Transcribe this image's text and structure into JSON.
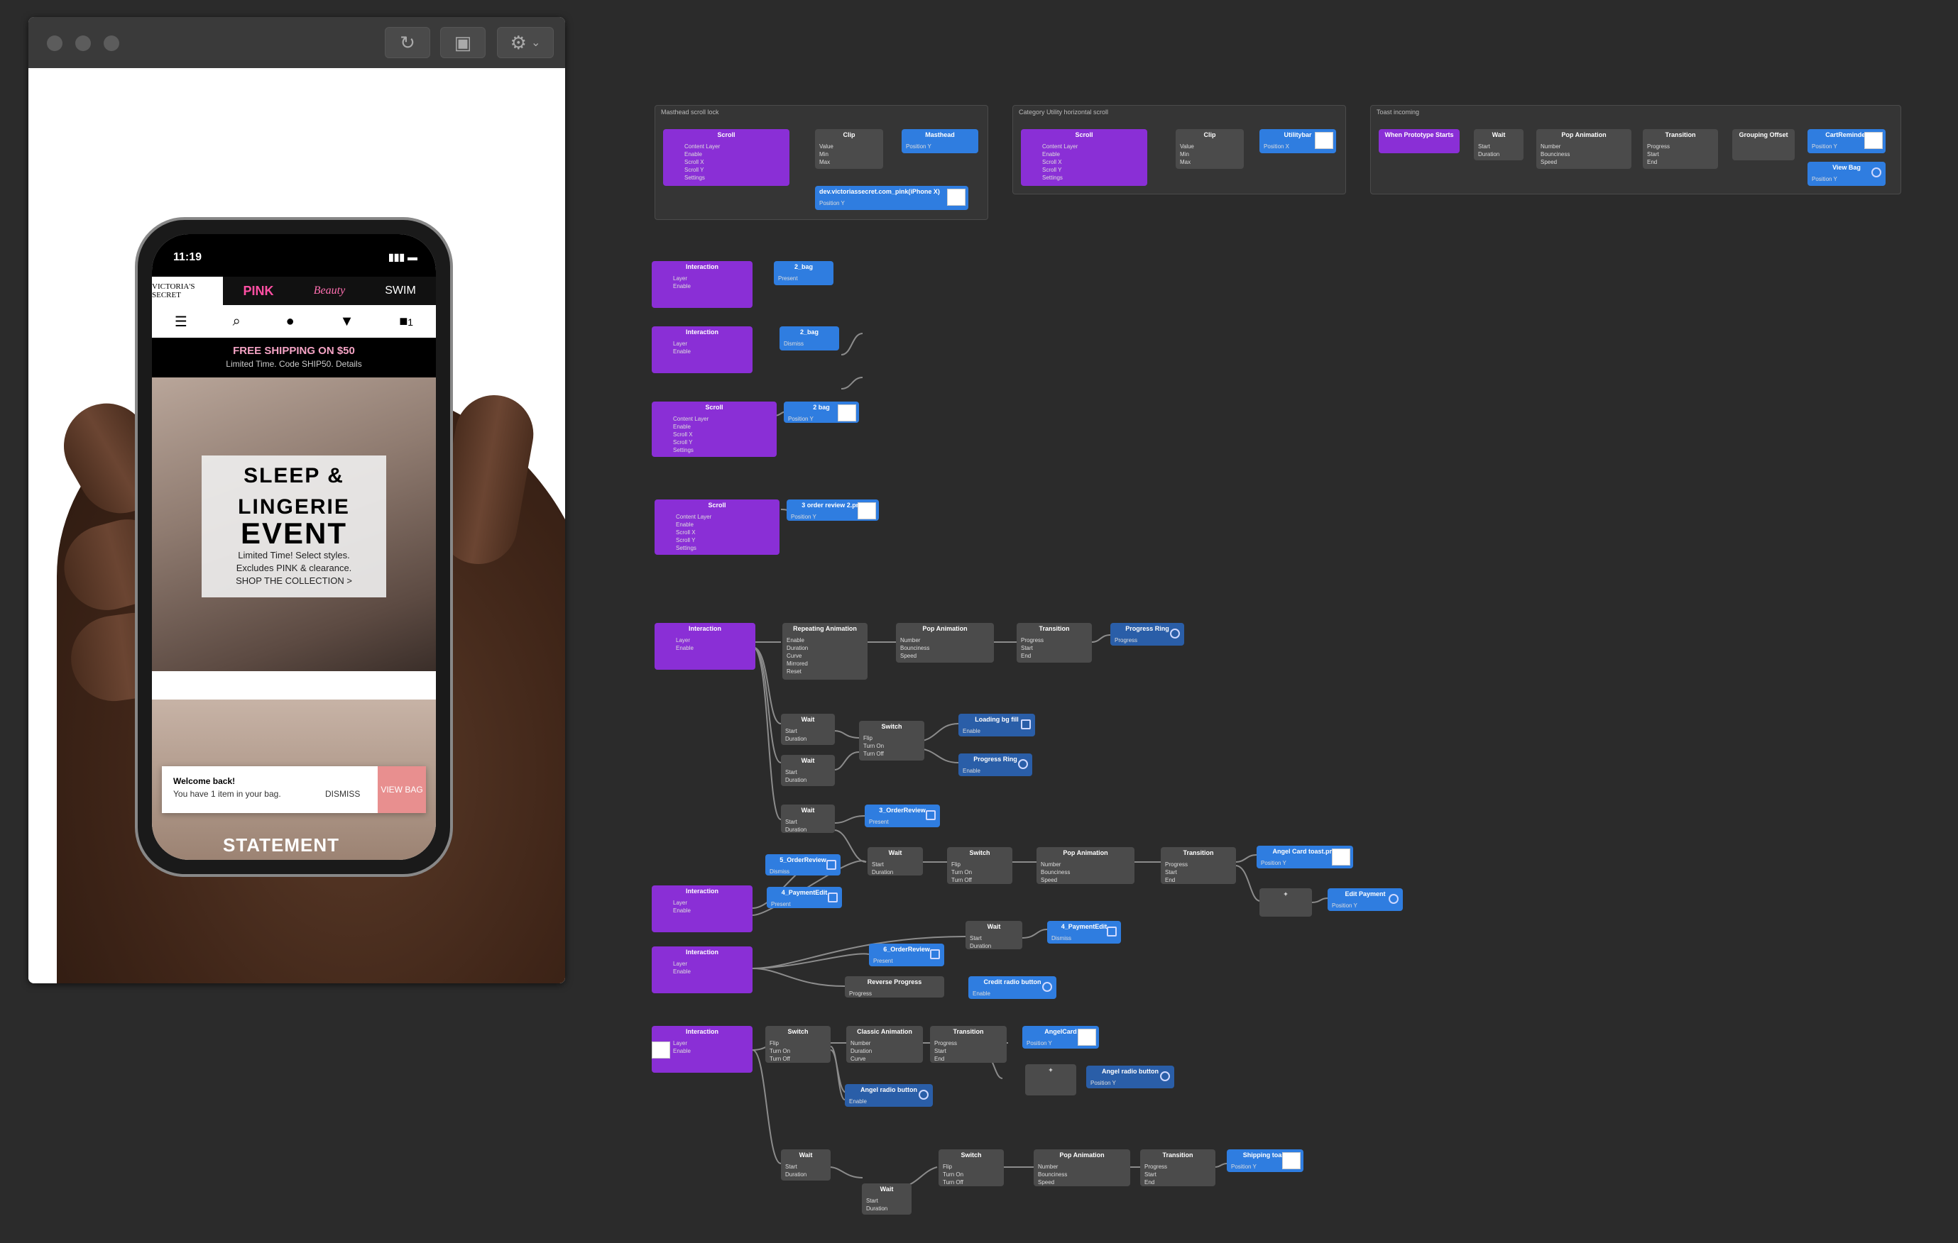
{
  "phone": {
    "time": "11:19",
    "brands": [
      "VICTORIA'S SECRET",
      "PINK",
      "Beauty",
      "SWIM"
    ],
    "bag_count": "1",
    "promo_title": "FREE SHIPPING ON $50",
    "promo_sub": "Limited Time. Code SHIP50. Details",
    "hero_title1": "SLEEP &",
    "hero_title2": "LINGERIE",
    "hero_title3": "EVENT",
    "hero_copy1": "Limited Time! Select styles.",
    "hero_copy2": "Excludes PINK & clearance.",
    "hero_cta": "SHOP THE COLLECTION >",
    "toast_title": "Welcome back!",
    "toast_body": "You have 1 item in your bag.",
    "toast_dismiss": "DISMISS",
    "toast_view": "VIEW BAG",
    "statement": "STATEMENT"
  },
  "groups": {
    "masthead": "Masthead scroll lock",
    "category": "Category Utility horizontal scroll",
    "toast": "Toast incoming"
  },
  "nodes": {
    "scroll": "Scroll",
    "clip": "Clip",
    "masthead": "Masthead",
    "utilitybar": "Utilitybar",
    "dev_url": "dev.victoriassecret.com_pink(iPhone X)",
    "when_start": "When Prototype Starts",
    "wait": "Wait",
    "pop_animation": "Pop Animation",
    "transition": "Transition",
    "grouping_offset": "Grouping Offset",
    "cart_reminder": "CartReminder",
    "view_bag": "View Bag",
    "interaction": "Interaction",
    "bag2_present": "2_bag",
    "bag2_dismiss": "2_bag",
    "bag2_pos": "2 bag",
    "order_review_png": "3 order review 2.png",
    "repeating": "Repeating Animation",
    "progress_ring": "Progress Ring",
    "loading_bg": "Loading bg fill",
    "switch": "Switch",
    "order3": "3_OrderReview",
    "angel_card_toast": "Angel Card toast.png",
    "order5": "5_OrderReview",
    "payment4": "4_PaymentEdit",
    "edit_payment": "Edit Payment",
    "order6": "6_OrderReview",
    "reverse": "Reverse Progress",
    "credit_radio": "Credit radio button",
    "classic": "Classic Animation",
    "angelcard": "AngelCard",
    "angel_radio_btn": "Angel radio button",
    "angel_radio_btn2": "Angel radio button",
    "shipping_toast": "Shipping toast",
    "plus": "+"
  },
  "ports": {
    "scroll": "Content Layer\nEnable\nScroll X\nScroll Y\nSettings",
    "clip": "Value\nMin\nMax",
    "pos_y": "Position Y",
    "pos_x": "Position X",
    "interaction": "Layer\nEnable",
    "present": "Present",
    "dismiss": "Dismiss",
    "wait": "Start\nDuration",
    "pop": "Number\nBounciness\nSpeed",
    "transition": "Progress\nStart\nEnd",
    "repeating": "Enable\nDuration\nCurve\nMirrored\nReset",
    "switch": "Flip\nTurn On\nTurn Off",
    "enable": "Enable",
    "progress": "Progress",
    "classic": "Number\nDuration\nCurve"
  }
}
